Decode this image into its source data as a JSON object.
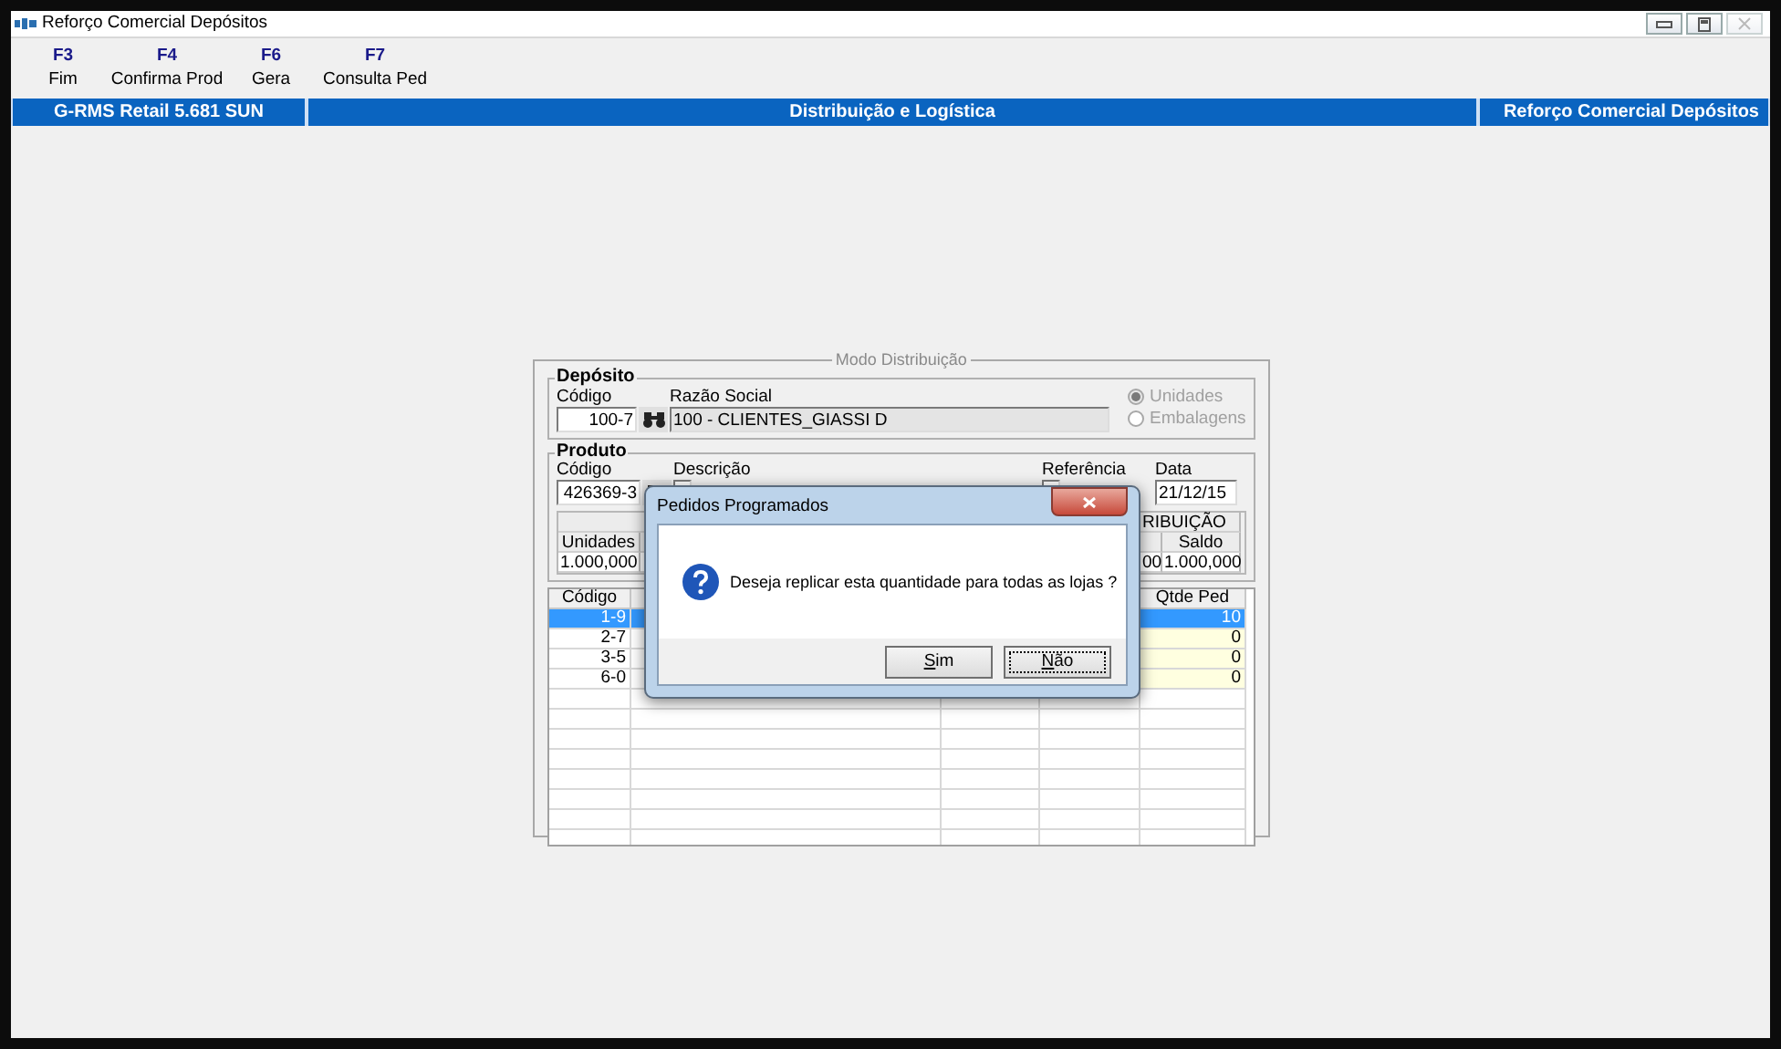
{
  "window": {
    "title": "Reforço Comercial Depósitos"
  },
  "toolbar": [
    {
      "key": "F3",
      "label": "Fim"
    },
    {
      "key": "F4",
      "label": "Confirma Prod"
    },
    {
      "key": "F6",
      "label": "Gera"
    },
    {
      "key": "F7",
      "label": "Consulta Ped"
    }
  ],
  "header_bar": {
    "left": "G-RMS Retail 5.681  SUN",
    "center": "Distribuição e Logística",
    "right": "Reforço Comercial Depósitos"
  },
  "form": {
    "title": "Modo Distribuição",
    "deposito": {
      "title": "Depósito",
      "codigo_label": "Código",
      "codigo": "100-7",
      "razao_label": "Razão Social",
      "razao": "100 - CLIENTES_GIASSI D",
      "options": [
        {
          "label": "Unidades",
          "selected": true
        },
        {
          "label": "Embalagens",
          "selected": false
        }
      ],
      "options_disabled": true
    },
    "produto": {
      "title": "Produto",
      "codigo_label": "Código",
      "codigo": "426369-3",
      "descricao_label": "Descrição",
      "referencia_label": "Referência",
      "data_label": "Data",
      "data": "21/12/15",
      "summary": {
        "group_header": "RIBUIÇÃO",
        "col_unidades": "Unidades",
        "col_saldo": "Saldo",
        "unidades": "1.000,000",
        "cut_value": "00",
        "saldo": "1.000,000"
      }
    },
    "grid": {
      "columns": [
        "Código",
        "Qtde Ped"
      ],
      "rows": [
        {
          "codigo": "1-9",
          "qtde": "10",
          "selected": true
        },
        {
          "codigo": "2-7",
          "qtde": "0",
          "selected": false
        },
        {
          "codigo": "3-5",
          "qtde": "0",
          "selected": false
        },
        {
          "codigo": "6-0",
          "qtde": "0",
          "selected": false
        }
      ]
    }
  },
  "dialog": {
    "title": "Pedidos Programados",
    "message": "Deseja replicar esta quantidade para todas as lojas ?",
    "buttons": [
      {
        "label": "Sim",
        "focused": false
      },
      {
        "label": "Não",
        "focused": true
      }
    ]
  }
}
